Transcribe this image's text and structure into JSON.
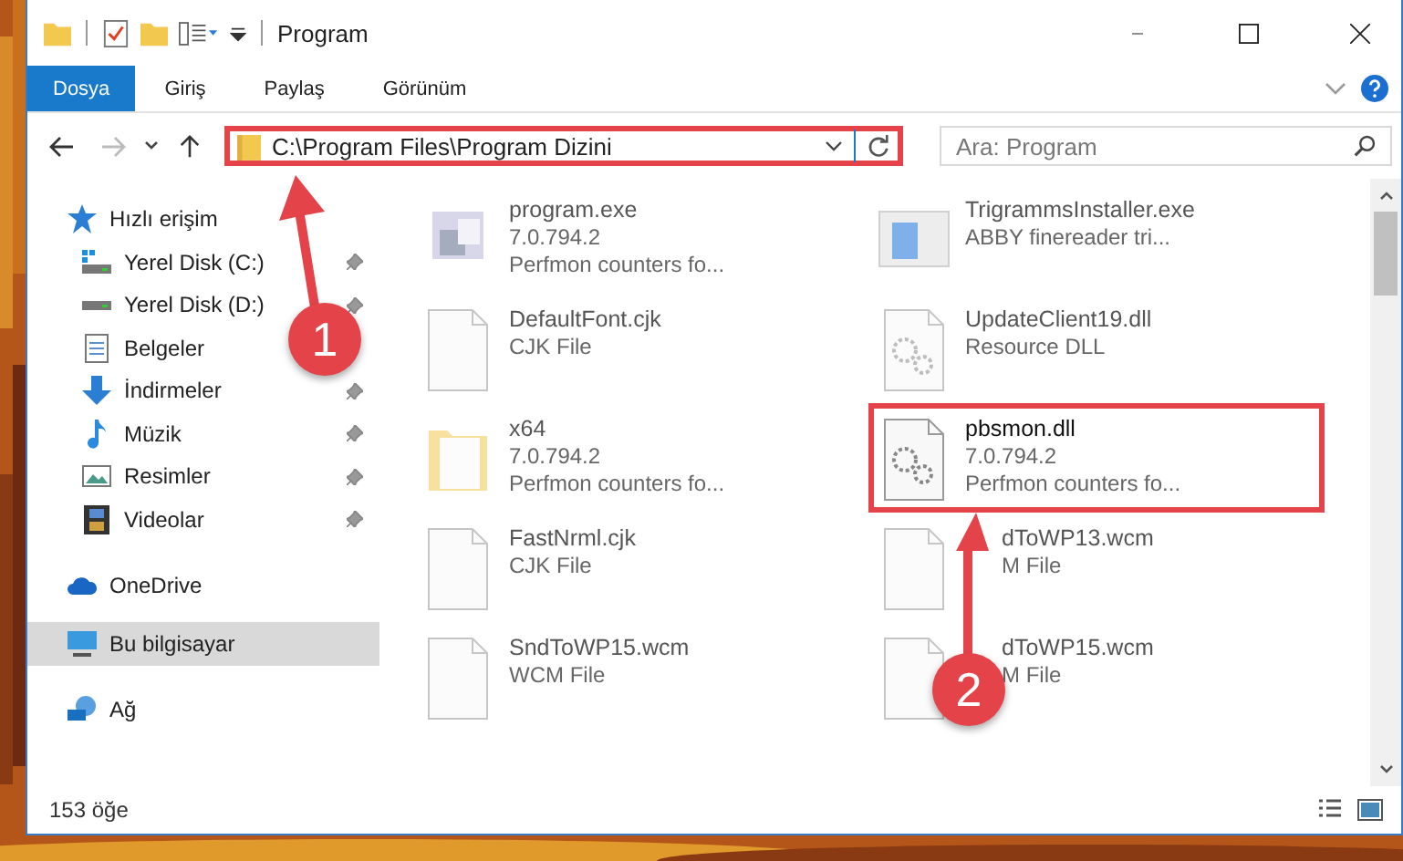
{
  "window": {
    "title": "Program"
  },
  "ribbon_tabs": [
    {
      "label": "Dosya",
      "selected": true
    },
    {
      "label": "Giriş",
      "selected": false
    },
    {
      "label": "Paylaş",
      "selected": false
    },
    {
      "label": "Görünüm",
      "selected": false
    }
  ],
  "address": {
    "path": "C:\\Program Files\\Program Dizini",
    "highlighted": true
  },
  "search": {
    "placeholder": "Ara: Program"
  },
  "sidebar": {
    "items": [
      {
        "label": "Hızlı erişim",
        "kind": "star",
        "selected": false,
        "children": [
          {
            "label": "Yerel Disk (C:)",
            "kind": "disk-c",
            "pinned": true,
            "selected": false
          },
          {
            "label": "Yerel Disk (D:)",
            "kind": "disk",
            "pinned": true,
            "selected": false
          },
          {
            "label": "Belgeler",
            "kind": "docs",
            "pinned": false,
            "selected": false
          },
          {
            "label": "İndirmeler",
            "kind": "download",
            "pinned": true,
            "selected": false
          },
          {
            "label": "Müzik",
            "kind": "music",
            "pinned": true,
            "selected": false
          },
          {
            "label": "Resimler",
            "kind": "pictures",
            "pinned": true,
            "selected": false
          },
          {
            "label": "Videolar",
            "kind": "videos",
            "pinned": true,
            "selected": false
          }
        ]
      },
      {
        "label": "OneDrive",
        "kind": "cloud",
        "selected": false
      },
      {
        "label": "Bu bilgisayar",
        "kind": "computer",
        "selected": true
      },
      {
        "label": "Ağ",
        "kind": "network",
        "selected": false
      }
    ]
  },
  "files": [
    {
      "name": "program.exe",
      "lines": [
        "7.0.794.2",
        "Perfmon counters fo..."
      ],
      "kind": "exe",
      "blurred": true,
      "highlighted": false,
      "covered": false
    },
    {
      "name": "TrigrammsInstaller.exe",
      "lines": [
        "ABBY finereader tri..."
      ],
      "kind": "installer",
      "blurred": true,
      "highlighted": false,
      "covered": false
    },
    {
      "name": "DefaultFont.cjk",
      "lines": [
        "CJK File"
      ],
      "kind": "blank",
      "blurred": true,
      "highlighted": false,
      "covered": false
    },
    {
      "name": "UpdateClient19.dll",
      "lines": [
        "Resource DLL"
      ],
      "kind": "dll",
      "blurred": true,
      "highlighted": false,
      "covered": false
    },
    {
      "name": "x64",
      "lines": [
        "7.0.794.2",
        "Perfmon counters fo..."
      ],
      "kind": "folder",
      "blurred": true,
      "highlighted": false,
      "covered": false
    },
    {
      "name": "pbsmon.dll",
      "lines": [
        "7.0.794.2",
        "Perfmon counters fo..."
      ],
      "kind": "dll",
      "blurred": false,
      "highlighted": true,
      "covered": false
    },
    {
      "name": "FastNrml.cjk",
      "lines": [
        "CJK File"
      ],
      "kind": "blank",
      "blurred": true,
      "highlighted": false,
      "covered": false
    },
    {
      "name": "dToWP13.wcm",
      "lines": [
        "M File"
      ],
      "kind": "blank",
      "blurred": true,
      "highlighted": false,
      "covered": true
    },
    {
      "name": "SndToWP15.wcm",
      "lines": [
        "WCM File"
      ],
      "kind": "blank",
      "blurred": true,
      "highlighted": false,
      "covered": false
    },
    {
      "name": "dToWP15.wcm",
      "lines": [
        "M File"
      ],
      "kind": "blank",
      "blurred": true,
      "highlighted": false,
      "covered": true
    }
  ],
  "status_bar": {
    "count": "153 öğe"
  },
  "annotations": [
    {
      "label": "1"
    },
    {
      "label": "2"
    }
  ]
}
